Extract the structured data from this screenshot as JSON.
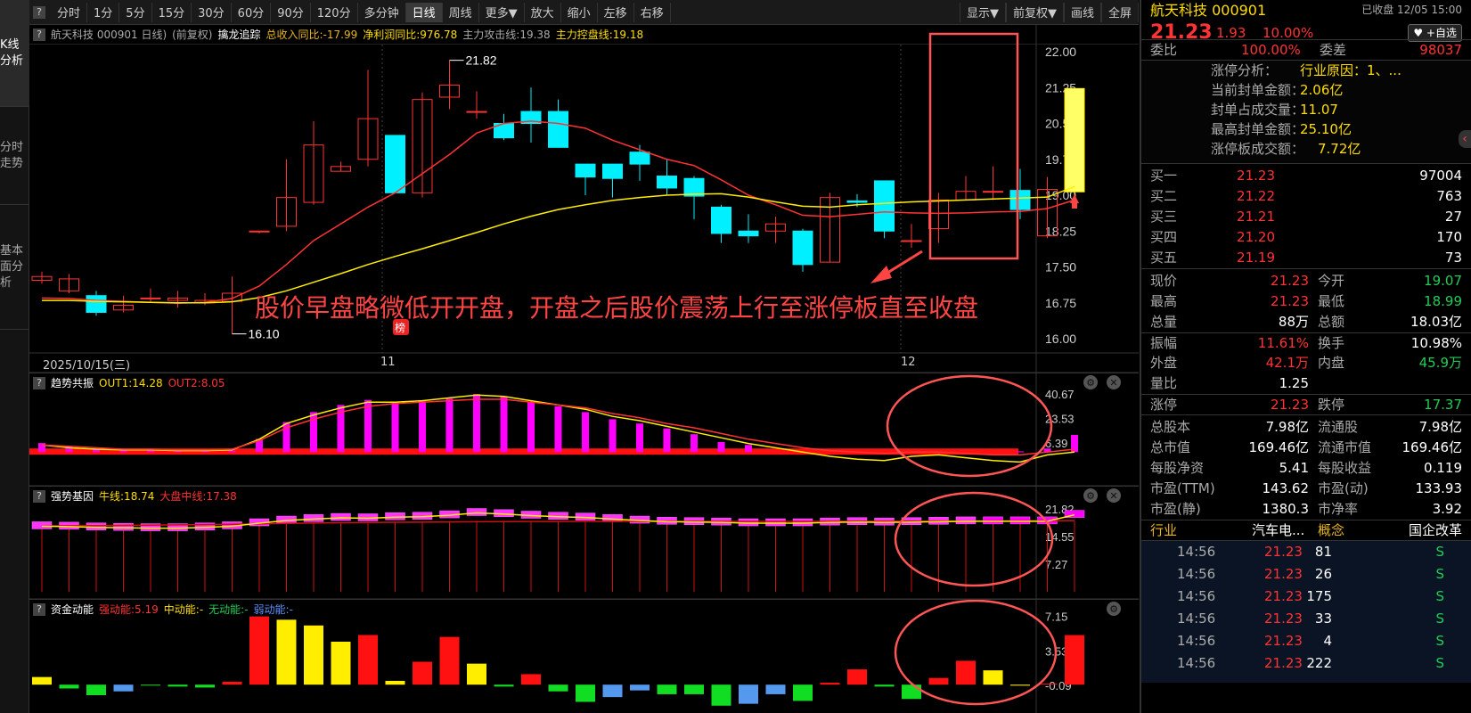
{
  "sidebar": {
    "tabs": [
      {
        "label": "K线分析",
        "chars": [
          "K",
          "线",
          "分",
          "析"
        ],
        "active": true
      },
      {
        "label": "分时走势",
        "chars": [
          "分",
          "时",
          "走",
          "势"
        ],
        "active": false
      },
      {
        "label": "基本面分析",
        "chars": [
          "基",
          "本",
          "面",
          "分",
          "析"
        ],
        "active": false
      }
    ]
  },
  "toolbar": {
    "help": "?",
    "items": [
      "分时",
      "1分",
      "5分",
      "15分",
      "30分",
      "60分",
      "90分",
      "120分",
      "多分钟",
      "日线",
      "周线",
      "更多▼",
      "放大",
      "缩小",
      "左移",
      "右移"
    ],
    "active": "日线",
    "right_items": [
      "显示▼",
      "前复权▼",
      "画线",
      "全屏"
    ]
  },
  "infobar": {
    "title": "航天科技 000901 日线)",
    "adjust": "(前复权)",
    "indicator": "擒龙追踪",
    "rev_label": "总收入同比:-17.99",
    "profit_label": "净利润同比:976.78",
    "attack_label": "主力攻击线:19.38",
    "control_label": "主力控盘线:19.18"
  },
  "main_chart": {
    "y_ticks": [
      "22.00",
      "21.25",
      "20.50",
      "19.75",
      "19.00",
      "18.25",
      "17.50",
      "16.75",
      "16.00"
    ],
    "high_label": "21.82",
    "low_label": "16.10",
    "bang": "榜"
  },
  "datebar": {
    "first": "2025/10/15(三)",
    "m11": "11",
    "m12": "12"
  },
  "annotation": "股价早盘略微低开开盘，开盘之后股价震荡上行至涨停板直至收盘",
  "panel1": {
    "name": "趋势共振",
    "out1": "OUT1:14.28",
    "out2": "OUT2:8.05",
    "ticks": [
      "40.67",
      "23.53",
      "6.39"
    ]
  },
  "panel2": {
    "name": "强势基因",
    "niu": "牛线:18.74",
    "dapan": "大盘中线:17.38",
    "ticks": [
      "21.82",
      "14.55",
      "7.27"
    ]
  },
  "panel3": {
    "name": "资金动能",
    "strong": "强动能:5.19",
    "mid": "中动能:-",
    "none": "无动能:-",
    "weak": "弱动能:-",
    "ticks": [
      "7.15",
      "3.53",
      "-0.09"
    ]
  },
  "quote": {
    "name": "航天科技 000901",
    "status": "已收盘 12/05 15:00",
    "price": "21.23",
    "change": "1.93",
    "pct": "10.00%",
    "fav": "♥ +自选",
    "weibi_label": "委比",
    "weibi": "100.00%",
    "weicha_label": "委差",
    "weicha": "98037",
    "zt": [
      {
        "k": "涨停分析：",
        "v": "行业原因：1、..."
      },
      {
        "k": "当前封单金额：",
        "v": "2.06亿"
      },
      {
        "k": "封单占成交量：",
        "v": "11.07"
      },
      {
        "k": "最高封单金额：",
        "v": "25.10亿"
      },
      {
        "k": "涨停板成交额：",
        "v": "7.72亿"
      }
    ],
    "bids": [
      {
        "l": "买一",
        "p": "21.23",
        "v": "97004"
      },
      {
        "l": "买二",
        "p": "21.22",
        "v": "763"
      },
      {
        "l": "买三",
        "p": "21.21",
        "v": "27"
      },
      {
        "l": "买四",
        "p": "21.20",
        "v": "170"
      },
      {
        "l": "买五",
        "p": "21.19",
        "v": "73"
      }
    ],
    "stats": [
      {
        "a": "现价",
        "av": "21.23",
        "ac": "red",
        "b": "今开",
        "bv": "19.07",
        "bc": "green"
      },
      {
        "a": "最高",
        "av": "21.23",
        "ac": "red",
        "b": "最低",
        "bv": "18.99",
        "bc": "green"
      },
      {
        "a": "总量",
        "av": "88万",
        "ac": "white",
        "b": "总额",
        "bv": "18.03亿",
        "bc": "white"
      },
      {
        "a": "振幅",
        "av": "11.61%",
        "ac": "red",
        "b": "换手",
        "bv": "10.98%",
        "bc": "white"
      },
      {
        "a": "外盘",
        "av": "42.1万",
        "ac": "red",
        "b": "内盘",
        "bv": "45.9万",
        "bc": "green"
      },
      {
        "a": "量比",
        "av": "1.25",
        "ac": "white",
        "b": "",
        "bv": "",
        "bc": "white"
      },
      {
        "a": "涨停",
        "av": "21.23",
        "ac": "red",
        "b": "跌停",
        "bv": "17.37",
        "bc": "green"
      }
    ],
    "fund": [
      {
        "a": "总股本",
        "av": "7.98亿",
        "b": "流通股",
        "bv": "7.98亿"
      },
      {
        "a": "总市值",
        "av": "169.46亿",
        "b": "流通市值",
        "bv": "169.46亿"
      },
      {
        "a": "每股净资",
        "av": "5.41",
        "b": "每股收益",
        "bv": "0.119"
      },
      {
        "a": "市盈(TTM)",
        "av": "143.62",
        "b": "市盈(动)",
        "bv": "133.93"
      },
      {
        "a": "市盈(静)",
        "av": "1380.3",
        "b": "市净率",
        "bv": "3.92"
      }
    ],
    "industry_label": "行业",
    "industry": "汽车电...",
    "concept_label": "概念",
    "concept": "国企改革",
    "ticks": [
      {
        "t": "14:56",
        "p": "21.23",
        "v": "81",
        "s": "S"
      },
      {
        "t": "14:56",
        "p": "21.23",
        "v": "26",
        "s": "S"
      },
      {
        "t": "14:56",
        "p": "21.23",
        "v": "175",
        "s": "S"
      },
      {
        "t": "14:56",
        "p": "21.23",
        "v": "33",
        "s": "S"
      },
      {
        "t": "14:56",
        "p": "21.23",
        "v": "4",
        "s": "S"
      },
      {
        "t": "14:56",
        "p": "21.23",
        "v": "222",
        "s": "S"
      }
    ]
  },
  "chart_data": [
    {
      "type": "candlestick",
      "title": "航天科技 000901 日线",
      "ylim": [
        16.0,
        22.0
      ],
      "ohlc": [
        [
          17.22,
          17.3,
          17.15,
          17.4
        ],
        [
          17.0,
          17.25,
          16.95,
          17.35
        ],
        [
          16.9,
          16.55,
          16.48,
          17.0
        ],
        [
          16.6,
          16.7,
          16.55,
          16.9
        ],
        [
          16.85,
          16.85,
          16.75,
          17.05
        ],
        [
          16.8,
          16.85,
          16.65,
          17.0
        ],
        [
          16.75,
          16.8,
          16.7,
          16.95
        ],
        [
          16.78,
          16.95,
          16.1,
          17.3
        ],
        [
          18.25,
          18.25,
          18.2,
          18.25
        ],
        [
          18.35,
          18.95,
          18.25,
          19.75
        ],
        [
          18.85,
          20.05,
          18.8,
          20.55
        ],
        [
          19.5,
          19.6,
          19.5,
          19.7
        ],
        [
          19.75,
          20.6,
          19.6,
          21.62
        ],
        [
          20.25,
          19.05,
          19.05,
          20.25
        ],
        [
          19.05,
          21.0,
          18.95,
          21.15
        ],
        [
          21.05,
          21.3,
          20.8,
          21.82
        ],
        [
          20.75,
          20.75,
          20.6,
          21.17
        ],
        [
          20.5,
          20.2,
          20.15,
          20.7
        ],
        [
          20.75,
          20.5,
          20.1,
          21.25
        ],
        [
          20.75,
          20.0,
          20.0,
          21.0
        ],
        [
          19.65,
          19.38,
          19.0,
          19.65
        ],
        [
          19.65,
          19.35,
          18.95,
          19.65
        ],
        [
          19.9,
          19.65,
          19.3,
          20.05
        ],
        [
          19.4,
          19.15,
          19.0,
          19.75
        ],
        [
          19.35,
          18.98,
          18.5,
          19.4
        ],
        [
          18.75,
          18.2,
          18.0,
          18.8
        ],
        [
          18.25,
          18.15,
          18.0,
          18.6
        ],
        [
          18.25,
          18.4,
          18.0,
          18.55
        ],
        [
          18.25,
          17.55,
          17.4,
          18.3
        ],
        [
          17.6,
          18.95,
          17.6,
          19.05
        ],
        [
          18.88,
          18.85,
          18.75,
          19.02
        ],
        [
          19.3,
          18.25,
          18.1,
          19.3
        ],
        [
          18.05,
          18.05,
          17.9,
          18.4
        ],
        [
          18.3,
          18.9,
          18.0,
          19.05
        ],
        [
          18.9,
          19.08,
          18.9,
          19.4
        ],
        [
          19.08,
          19.08,
          18.9,
          19.6
        ],
        [
          19.1,
          18.7,
          18.5,
          19.55
        ],
        [
          18.15,
          19.12,
          18.1,
          19.38
        ],
        [
          19.07,
          21.23,
          18.99,
          21.23
        ]
      ],
      "ma1": [
        16.85,
        16.84,
        16.8,
        16.78,
        16.76,
        16.74,
        16.76,
        16.84,
        17.1,
        17.55,
        18.05,
        18.4,
        18.75,
        19.05,
        19.45,
        19.85,
        20.3,
        20.5,
        20.55,
        20.5,
        20.4,
        20.15,
        19.95,
        19.75,
        19.62,
        19.32,
        19.0,
        18.8,
        18.58,
        18.55,
        18.6,
        18.65,
        18.63,
        18.62,
        18.63,
        18.65,
        18.66,
        18.72,
        18.9
      ],
      "ma2": [
        16.8,
        16.8,
        16.78,
        16.77,
        16.76,
        16.75,
        16.75,
        16.77,
        16.86,
        17.0,
        17.18,
        17.36,
        17.55,
        17.72,
        17.88,
        18.05,
        18.22,
        18.4,
        18.56,
        18.7,
        18.8,
        18.89,
        18.95,
        19.0,
        19.02,
        19.03,
        18.96,
        18.86,
        18.77,
        18.75,
        18.8,
        18.83,
        18.86,
        18.88,
        18.9,
        18.92,
        18.94,
        18.96,
        19.18
      ]
    },
    {
      "type": "bar",
      "title": "趋势共振",
      "ylim": [
        0,
        40.67
      ],
      "bars": [
        6.3,
        4.2,
        2.0,
        1.4,
        1.6,
        1.0,
        0.9,
        1.1,
        9.2,
        21.0,
        28.0,
        33.0,
        36.5,
        35.0,
        36.0,
        37.5,
        40.67,
        39.0,
        35.0,
        32.0,
        28.0,
        23.0,
        20.0,
        16.5,
        12.5,
        7.0,
        5.0
      ],
      "out1": [
        5,
        3,
        2,
        1.5,
        1.5,
        1,
        1,
        1.5,
        9,
        20,
        26,
        31,
        35,
        35,
        36,
        38,
        40,
        39,
        36,
        33,
        30,
        25,
        22,
        18,
        14,
        10,
        6,
        3,
        0,
        -3,
        -5,
        -6,
        -3,
        -2,
        -4,
        -6,
        -7,
        -2,
        0,
        5,
        10
      ],
      "out2": [
        5,
        4,
        3,
        2,
        2,
        1.5,
        1.5,
        2,
        8,
        17,
        23,
        28,
        32,
        34,
        35,
        36,
        37,
        37,
        35,
        33,
        31,
        27,
        24,
        20,
        17,
        13,
        9,
        6,
        3,
        1,
        0,
        -1,
        0,
        0,
        -1,
        -2,
        -2,
        0,
        2,
        5,
        8
      ]
    },
    {
      "type": "bar",
      "title": "强势基因",
      "ylim": [
        0,
        21.82
      ],
      "niu": [
        17.5,
        17.4,
        17.2,
        17.1,
        17.0,
        17.0,
        17.2,
        17.5,
        18.3,
        19.0,
        19.4,
        19.7,
        19.6,
        19.9,
        20.0,
        20.4,
        21.0,
        20.7,
        20.3,
        20.0,
        19.8,
        19.4,
        19.0,
        18.7,
        18.6,
        18.5,
        18.3,
        18.3,
        18.3,
        18.5,
        18.6,
        18.5,
        18.6,
        18.7,
        18.8,
        18.8,
        18.8,
        18.8,
        20.5
      ],
      "dapan": [
        17.38,
        17.4,
        17.43,
        17.48,
        17.55,
        17.63,
        17.7,
        17.78,
        17.88,
        18.0,
        18.1,
        18.18,
        18.25,
        18.3,
        18.35,
        18.4,
        18.45,
        18.48,
        18.5,
        18.52,
        18.54,
        18.55,
        18.55,
        18.55,
        18.55,
        18.55,
        18.55,
        18.55,
        18.55,
        18.56,
        18.57,
        18.58,
        18.6,
        18.62,
        18.64,
        18.66,
        18.68,
        18.7,
        18.74
      ]
    },
    {
      "type": "bar",
      "title": "资金动能",
      "ylim": [
        -0.09,
        7.15
      ],
      "values": [
        0.8,
        -0.4,
        -1.1,
        -0.7,
        0.0,
        -0.2,
        -0.3,
        0.3,
        7.15,
        6.8,
        6.2,
        4.5,
        5.2,
        0.4,
        2.4,
        5.0,
        2.2,
        -0.2,
        1.1,
        -0.7,
        -1.8,
        -1.3,
        -0.6,
        -1.0,
        -1.0,
        -2.2,
        -2.0,
        -1.0,
        -1.7,
        0.2,
        1.6,
        -0.2,
        -1.5,
        0.7,
        2.5,
        1.5,
        -0.1,
        0.1,
        5.19
      ],
      "colors": [
        "yellow",
        "green",
        "green",
        "blue",
        "green",
        "green",
        "green",
        "red",
        "red",
        "yellow",
        "yellow",
        "yellow",
        "red",
        "yellow",
        "red",
        "red",
        "yellow",
        "green",
        "red",
        "green",
        "green",
        "blue",
        "blue",
        "green",
        "green",
        "green",
        "blue",
        "blue",
        "green",
        "red",
        "red",
        "green",
        "green",
        "red",
        "red",
        "yellow",
        "yellow",
        "red",
        "red"
      ]
    }
  ],
  "colors": {
    "up": "#ff3333",
    "down": "#00f0ff",
    "ma1": "#ff3333",
    "ma2": "#ffee00",
    "magenta": "#ff00ff",
    "bg": "#000000"
  }
}
